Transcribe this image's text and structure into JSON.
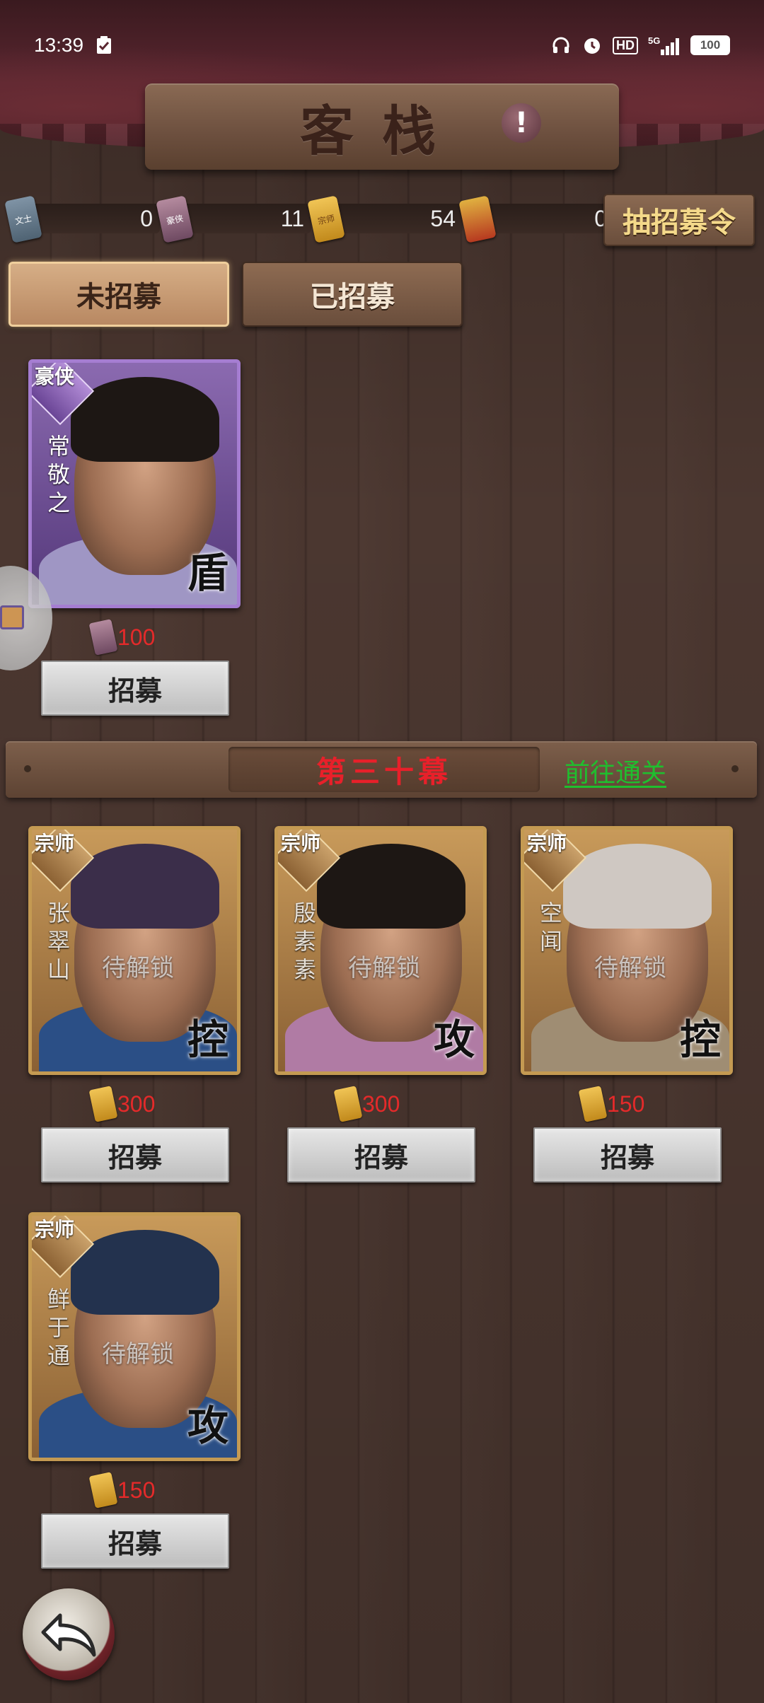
{
  "status_bar": {
    "time": "13:39",
    "network": "5G",
    "hd": "HD",
    "battery": "100"
  },
  "header": {
    "title": "客栈",
    "info_symbol": "!"
  },
  "currencies": [
    {
      "icon": "wenshi-token-icon",
      "label": "文士",
      "amount": "0"
    },
    {
      "icon": "haoxia-token-icon",
      "label": "豪侠",
      "amount": "11"
    },
    {
      "icon": "zongshi-token-icon",
      "label": "宗师",
      "amount": "54"
    },
    {
      "icon": "red-token-icon",
      "label": "",
      "amount": "0"
    }
  ],
  "draw_button": "抽招募令",
  "tabs": [
    {
      "label": "未招募",
      "active": true
    },
    {
      "label": "已招募",
      "active": false
    }
  ],
  "featured": {
    "rank": "豪侠",
    "name": "常敬之",
    "role": "盾",
    "cost": "100",
    "button": "招募"
  },
  "chapter": {
    "title": "第三十幕",
    "goto": "前往通关"
  },
  "heroes": [
    {
      "rank": "宗师",
      "name": "张翠山",
      "lock": "待解锁",
      "role": "控",
      "cost": "300",
      "button": "招募"
    },
    {
      "rank": "宗师",
      "name": "殷素素",
      "lock": "待解锁",
      "role": "攻",
      "cost": "300",
      "button": "招募"
    },
    {
      "rank": "宗师",
      "name": "空闻",
      "lock": "待解锁",
      "role": "控",
      "cost": "150",
      "button": "招募"
    },
    {
      "rank": "宗师",
      "name": "鲜于通",
      "lock": "待解锁",
      "role": "攻",
      "cost": "150",
      "button": "招募"
    }
  ],
  "colors": {
    "cost_red": "#e42a2a",
    "chapter_red": "#e8202a",
    "link_green": "#1fbf2e",
    "purple_frame": "#a57dd1",
    "gold_frame": "#c49a52"
  }
}
